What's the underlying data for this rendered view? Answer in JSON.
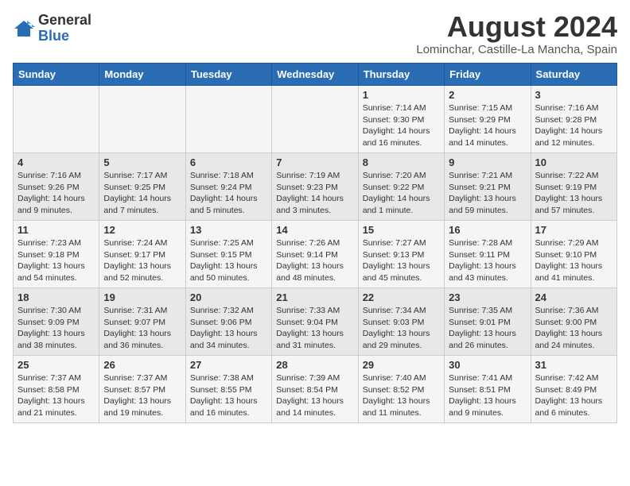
{
  "header": {
    "logo_general": "General",
    "logo_blue": "Blue",
    "month_title": "August 2024",
    "subtitle": "Lominchar, Castille-La Mancha, Spain"
  },
  "days_of_week": [
    "Sunday",
    "Monday",
    "Tuesday",
    "Wednesday",
    "Thursday",
    "Friday",
    "Saturday"
  ],
  "weeks": [
    [
      {
        "day": "",
        "sunrise": "",
        "sunset": "",
        "daylight": ""
      },
      {
        "day": "",
        "sunrise": "",
        "sunset": "",
        "daylight": ""
      },
      {
        "day": "",
        "sunrise": "",
        "sunset": "",
        "daylight": ""
      },
      {
        "day": "",
        "sunrise": "",
        "sunset": "",
        "daylight": ""
      },
      {
        "day": "1",
        "sunrise": "Sunrise: 7:14 AM",
        "sunset": "Sunset: 9:30 PM",
        "daylight": "Daylight: 14 hours and 16 minutes."
      },
      {
        "day": "2",
        "sunrise": "Sunrise: 7:15 AM",
        "sunset": "Sunset: 9:29 PM",
        "daylight": "Daylight: 14 hours and 14 minutes."
      },
      {
        "day": "3",
        "sunrise": "Sunrise: 7:16 AM",
        "sunset": "Sunset: 9:28 PM",
        "daylight": "Daylight: 14 hours and 12 minutes."
      }
    ],
    [
      {
        "day": "4",
        "sunrise": "Sunrise: 7:16 AM",
        "sunset": "Sunset: 9:26 PM",
        "daylight": "Daylight: 14 hours and 9 minutes."
      },
      {
        "day": "5",
        "sunrise": "Sunrise: 7:17 AM",
        "sunset": "Sunset: 9:25 PM",
        "daylight": "Daylight: 14 hours and 7 minutes."
      },
      {
        "day": "6",
        "sunrise": "Sunrise: 7:18 AM",
        "sunset": "Sunset: 9:24 PM",
        "daylight": "Daylight: 14 hours and 5 minutes."
      },
      {
        "day": "7",
        "sunrise": "Sunrise: 7:19 AM",
        "sunset": "Sunset: 9:23 PM",
        "daylight": "Daylight: 14 hours and 3 minutes."
      },
      {
        "day": "8",
        "sunrise": "Sunrise: 7:20 AM",
        "sunset": "Sunset: 9:22 PM",
        "daylight": "Daylight: 14 hours and 1 minute."
      },
      {
        "day": "9",
        "sunrise": "Sunrise: 7:21 AM",
        "sunset": "Sunset: 9:21 PM",
        "daylight": "Daylight: 13 hours and 59 minutes."
      },
      {
        "day": "10",
        "sunrise": "Sunrise: 7:22 AM",
        "sunset": "Sunset: 9:19 PM",
        "daylight": "Daylight: 13 hours and 57 minutes."
      }
    ],
    [
      {
        "day": "11",
        "sunrise": "Sunrise: 7:23 AM",
        "sunset": "Sunset: 9:18 PM",
        "daylight": "Daylight: 13 hours and 54 minutes."
      },
      {
        "day": "12",
        "sunrise": "Sunrise: 7:24 AM",
        "sunset": "Sunset: 9:17 PM",
        "daylight": "Daylight: 13 hours and 52 minutes."
      },
      {
        "day": "13",
        "sunrise": "Sunrise: 7:25 AM",
        "sunset": "Sunset: 9:15 PM",
        "daylight": "Daylight: 13 hours and 50 minutes."
      },
      {
        "day": "14",
        "sunrise": "Sunrise: 7:26 AM",
        "sunset": "Sunset: 9:14 PM",
        "daylight": "Daylight: 13 hours and 48 minutes."
      },
      {
        "day": "15",
        "sunrise": "Sunrise: 7:27 AM",
        "sunset": "Sunset: 9:13 PM",
        "daylight": "Daylight: 13 hours and 45 minutes."
      },
      {
        "day": "16",
        "sunrise": "Sunrise: 7:28 AM",
        "sunset": "Sunset: 9:11 PM",
        "daylight": "Daylight: 13 hours and 43 minutes."
      },
      {
        "day": "17",
        "sunrise": "Sunrise: 7:29 AM",
        "sunset": "Sunset: 9:10 PM",
        "daylight": "Daylight: 13 hours and 41 minutes."
      }
    ],
    [
      {
        "day": "18",
        "sunrise": "Sunrise: 7:30 AM",
        "sunset": "Sunset: 9:09 PM",
        "daylight": "Daylight: 13 hours and 38 minutes."
      },
      {
        "day": "19",
        "sunrise": "Sunrise: 7:31 AM",
        "sunset": "Sunset: 9:07 PM",
        "daylight": "Daylight: 13 hours and 36 minutes."
      },
      {
        "day": "20",
        "sunrise": "Sunrise: 7:32 AM",
        "sunset": "Sunset: 9:06 PM",
        "daylight": "Daylight: 13 hours and 34 minutes."
      },
      {
        "day": "21",
        "sunrise": "Sunrise: 7:33 AM",
        "sunset": "Sunset: 9:04 PM",
        "daylight": "Daylight: 13 hours and 31 minutes."
      },
      {
        "day": "22",
        "sunrise": "Sunrise: 7:34 AM",
        "sunset": "Sunset: 9:03 PM",
        "daylight": "Daylight: 13 hours and 29 minutes."
      },
      {
        "day": "23",
        "sunrise": "Sunrise: 7:35 AM",
        "sunset": "Sunset: 9:01 PM",
        "daylight": "Daylight: 13 hours and 26 minutes."
      },
      {
        "day": "24",
        "sunrise": "Sunrise: 7:36 AM",
        "sunset": "Sunset: 9:00 PM",
        "daylight": "Daylight: 13 hours and 24 minutes."
      }
    ],
    [
      {
        "day": "25",
        "sunrise": "Sunrise: 7:37 AM",
        "sunset": "Sunset: 8:58 PM",
        "daylight": "Daylight: 13 hours and 21 minutes."
      },
      {
        "day": "26",
        "sunrise": "Sunrise: 7:37 AM",
        "sunset": "Sunset: 8:57 PM",
        "daylight": "Daylight: 13 hours and 19 minutes."
      },
      {
        "day": "27",
        "sunrise": "Sunrise: 7:38 AM",
        "sunset": "Sunset: 8:55 PM",
        "daylight": "Daylight: 13 hours and 16 minutes."
      },
      {
        "day": "28",
        "sunrise": "Sunrise: 7:39 AM",
        "sunset": "Sunset: 8:54 PM",
        "daylight": "Daylight: 13 hours and 14 minutes."
      },
      {
        "day": "29",
        "sunrise": "Sunrise: 7:40 AM",
        "sunset": "Sunset: 8:52 PM",
        "daylight": "Daylight: 13 hours and 11 minutes."
      },
      {
        "day": "30",
        "sunrise": "Sunrise: 7:41 AM",
        "sunset": "Sunset: 8:51 PM",
        "daylight": "Daylight: 13 hours and 9 minutes."
      },
      {
        "day": "31",
        "sunrise": "Sunrise: 7:42 AM",
        "sunset": "Sunset: 8:49 PM",
        "daylight": "Daylight: 13 hours and 6 minutes."
      }
    ]
  ]
}
